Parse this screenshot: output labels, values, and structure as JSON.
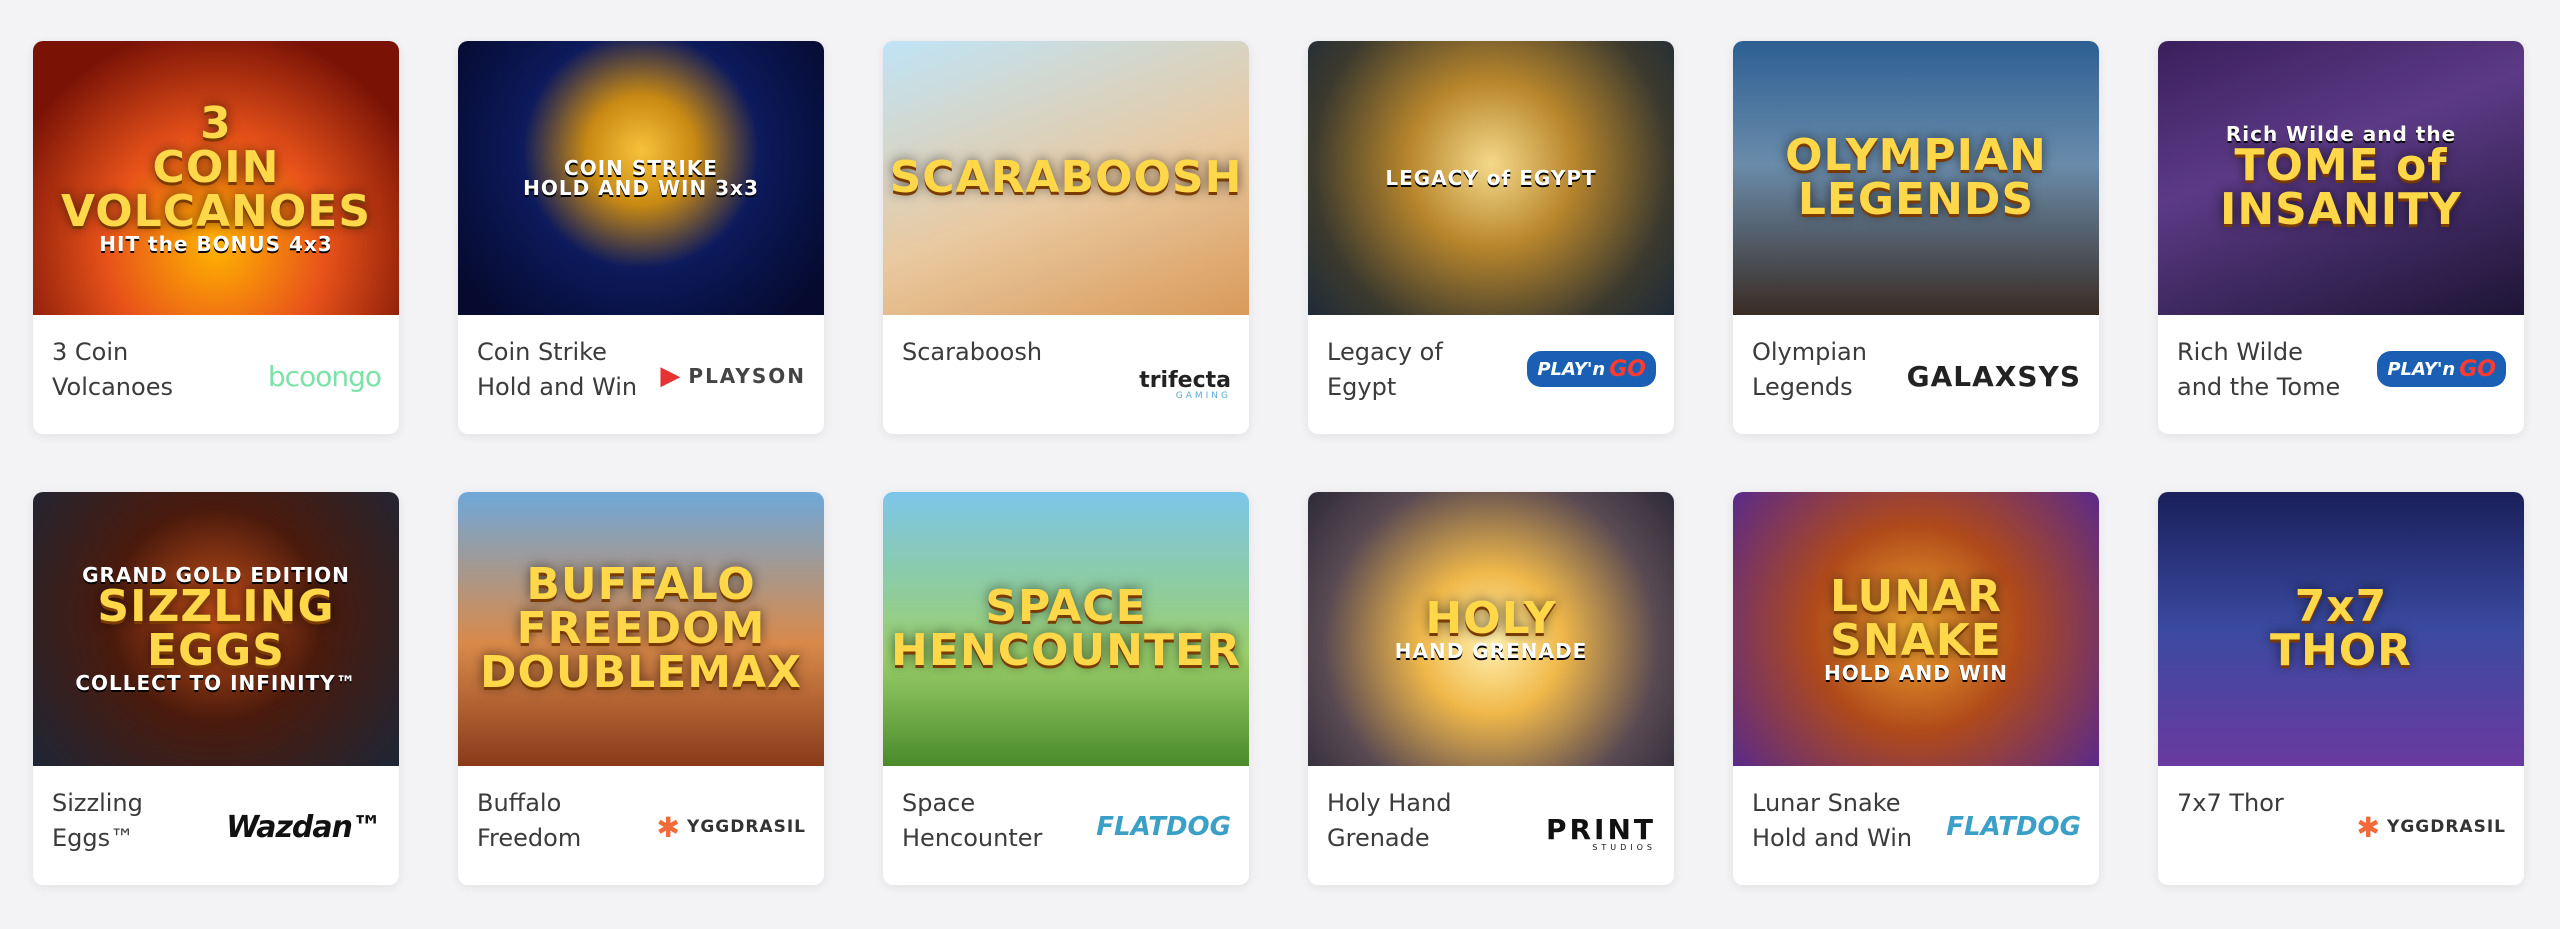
{
  "games": [
    {
      "title": "3 Coin Volcanoes",
      "art": [
        "3",
        "COIN",
        "VOLCANOES",
        "HIT the BONUS 4x3"
      ],
      "bg": "radial-gradient(circle at 50% 75%, #ffb300 0%, #e8521a 40%, #7a1306 80%)",
      "provider": {
        "name": "booongo",
        "label": "bcoongo",
        "icon": "booongo-logo"
      }
    },
    {
      "title": "Coin Strike Hold and Win",
      "art": [
        "COIN STRIKE",
        "HOLD AND WIN 3x3"
      ],
      "bg": "radial-gradient(circle at 50% 40%, #f7c23b 0%, #c98a13 22%, #0d1a5c 48%, #050a2e 90%)",
      "provider": {
        "name": "playson",
        "label": "PLAYSON",
        "icon": "playson-logo"
      }
    },
    {
      "title": "Scaraboosh",
      "art": [
        "SCARABOOSH"
      ],
      "bg": "linear-gradient(160deg, #bfe4f7 0%, #e9c9a0 55%, #d99a5a 100%)",
      "provider": {
        "name": "trifecta",
        "label": "trifecta",
        "sub": "GAMING",
        "icon": "trifecta-logo"
      }
    },
    {
      "title": "Legacy of Egypt",
      "art": [
        "LEGACY of EGYPT"
      ],
      "bg": "radial-gradient(circle at 50% 45%, #f4d98a 0%, #b8862c 35%, #3c3a2e 75%, #1f2a38 100%)",
      "provider": {
        "name": "playngo",
        "label": "PLAY'n",
        "badge": "GO",
        "icon": "playngo-logo"
      }
    },
    {
      "title": "Olympian Legends",
      "art": [
        "OLYMPIAN",
        "LEGENDS"
      ],
      "bg": "linear-gradient(180deg, #2d5f93 0%, #6a8cab 45%, #3a2c24 100%)",
      "provider": {
        "name": "galaxsys",
        "label": "GALAXSYS",
        "icon": "galaxsys-logo"
      }
    },
    {
      "title": "Rich Wilde and the Tome of Insanity",
      "art": [
        "Rich Wilde and the",
        "TOME of",
        "INSANITY"
      ],
      "bg": "linear-gradient(160deg, #3a1f5c 0%, #5c3a86 40%, #1d1535 100%)",
      "provider": {
        "name": "playngo",
        "label": "PLAY'n",
        "badge": "GO",
        "icon": "playngo-logo"
      }
    },
    {
      "title": "Sizzling Eggs™",
      "art": [
        "GRAND GOLD EDITION",
        "SIZZLING",
        "EGGS",
        "COLLECT TO INFINITY™"
      ],
      "bg": "radial-gradient(circle at 50% 45%, #c7501a 0%, #4a1a0c 45%, #1d2636 100%)",
      "provider": {
        "name": "wazdan",
        "label": "Wazdan™",
        "icon": "wazdan-logo"
      }
    },
    {
      "title": "Buffalo Freedom",
      "art": [
        "BUFFALO",
        "FREEDOM",
        "DOUBLEMAX"
      ],
      "bg": "linear-gradient(180deg, #6fa8d9 0%, #d98a4a 55%, #8a3a1a 100%)",
      "provider": {
        "name": "ygg",
        "label": "YGGDRASIL",
        "icon": "yggdrasil-logo"
      }
    },
    {
      "title": "Space Hencounter",
      "art": [
        "SPACE",
        "HENCOUNTER"
      ],
      "bg": "linear-gradient(180deg, #7cc6ea 0%, #9bd06a 60%, #4a8a2a 100%)",
      "provider": {
        "name": "flatdog",
        "label": "FLATDOG",
        "icon": "flatdog-logo"
      }
    },
    {
      "title": "Holy Hand Grenade",
      "art": [
        "HOLY",
        "HAND GRENADE"
      ],
      "bg": "radial-gradient(circle at 50% 55%, #fff1b0 0%, #f0b84a 30%, #5a4a52 70%, #2c2a38 100%)",
      "provider": {
        "name": "print",
        "label": "PRINT",
        "sub": "STUDIOS",
        "icon": "print-studios-logo"
      }
    },
    {
      "title": "Lunar Snake Hold and Win",
      "art": [
        "LUNAR",
        "SNAKE",
        "HOLD AND WIN"
      ],
      "bg": "radial-gradient(circle at 50% 50%, #f2a830 0%, #b04a1a 45%, #5a2a8a 100%)",
      "provider": {
        "name": "flatdog",
        "label": "FLATDOG",
        "icon": "flatdog-logo"
      }
    },
    {
      "title": "7x7 Thor",
      "art": [
        "7x7",
        "THOR"
      ],
      "bg": "linear-gradient(180deg, #1a1f5a 0%, #3a4aa0 50%, #6a3aa0 100%)",
      "provider": {
        "name": "ygg",
        "label": "YGGDRASIL",
        "icon": "yggdrasil-logo"
      }
    }
  ]
}
